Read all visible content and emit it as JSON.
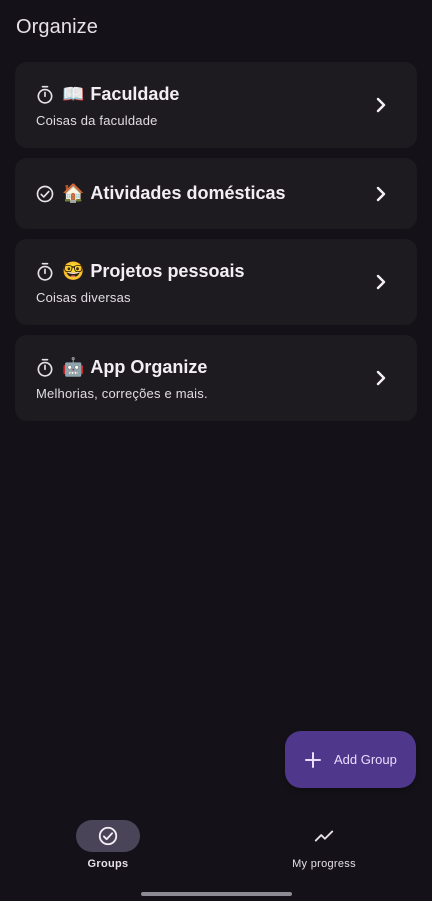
{
  "app": {
    "title": "Organize"
  },
  "groups": [
    {
      "status": "timer",
      "status_icon": "timer-icon",
      "emoji": "📖",
      "name": "Faculdade",
      "description": "Coisas da faculdade"
    },
    {
      "status": "done",
      "status_icon": "check-circle-icon",
      "emoji": "🏠",
      "name": "Atividades domésticas",
      "description": ""
    },
    {
      "status": "timer",
      "status_icon": "timer-icon",
      "emoji": "🤓",
      "name": "Projetos pessoais",
      "description": "Coisas diversas"
    },
    {
      "status": "timer",
      "status_icon": "timer-icon",
      "emoji": "🤖",
      "name": "App Organize",
      "description": "Melhorias, correções e mais."
    }
  ],
  "fab": {
    "label": "Add Group",
    "icon": "plus-icon"
  },
  "nav": {
    "items": [
      {
        "label": "Groups",
        "icon": "check-circle-icon",
        "selected": true
      },
      {
        "label": "My progress",
        "icon": "trending-up-icon",
        "selected": false
      }
    ]
  },
  "colors": {
    "background": "#141218",
    "card": "#1D1B20",
    "fab": "#4F378B",
    "nav_indicator": "#4A4458",
    "text": "#E6E0E9"
  }
}
